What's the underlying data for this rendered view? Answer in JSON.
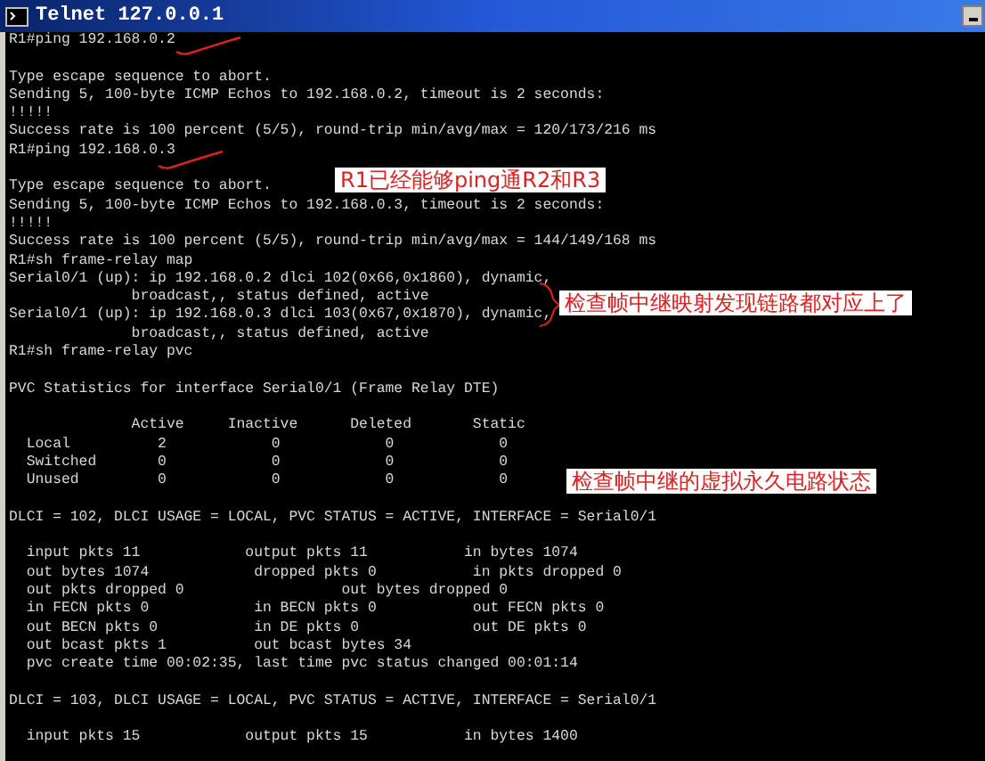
{
  "window": {
    "title": "Telnet 127.0.0.1"
  },
  "terminal": {
    "blocks": [
      {
        "lines": [
          "R1#ping 192.168.0.2"
        ]
      },
      {
        "lines": [
          "Type escape sequence to abort.",
          "Sending 5, 100-byte ICMP Echos to 192.168.0.2, timeout is 2 seconds:",
          "!!!!!",
          "Success rate is 100 percent (5/5), round-trip min/avg/max = 120/173/216 ms",
          "R1#ping 192.168.0.3"
        ]
      },
      {
        "lines": [
          "Type escape sequence to abort.",
          "Sending 5, 100-byte ICMP Echos to 192.168.0.3, timeout is 2 seconds:",
          "!!!!!",
          "Success rate is 100 percent (5/5), round-trip min/avg/max = 144/149/168 ms",
          "R1#sh frame-relay map",
          "Serial0/1 (up): ip 192.168.0.2 dlci 102(0x66,0x1860), dynamic,",
          "              broadcast,, status defined, active",
          "Serial0/1 (up): ip 192.168.0.3 dlci 103(0x67,0x1870), dynamic,",
          "              broadcast,, status defined, active",
          "R1#sh frame-relay pvc"
        ]
      },
      {
        "lines": [
          "PVC Statistics for interface Serial0/1 (Frame Relay DTE)"
        ]
      },
      {
        "lines": [
          "              Active     Inactive      Deleted       Static",
          "  Local          2            0            0            0",
          "  Switched       0            0            0            0",
          "  Unused         0            0            0            0"
        ]
      },
      {
        "lines": [
          "DLCI = 102, DLCI USAGE = LOCAL, PVC STATUS = ACTIVE, INTERFACE = Serial0/1"
        ]
      },
      {
        "lines": [
          "  input pkts 11            output pkts 11           in bytes 1074",
          "  out bytes 1074            dropped pkts 0           in pkts dropped 0",
          "  out pkts dropped 0                  out bytes dropped 0",
          "  in FECN pkts 0            in BECN pkts 0           out FECN pkts 0",
          "  out BECN pkts 0           in DE pkts 0             out DE pkts 0",
          "  out bcast pkts 1          out bcast bytes 34",
          "  pvc create time 00:02:35, last time pvc status changed 00:01:14"
        ]
      },
      {
        "lines": [
          "DLCI = 103, DLCI USAGE = LOCAL, PVC STATUS = ACTIVE, INTERFACE = Serial0/1"
        ]
      },
      {
        "lines": [
          "  input pkts 15            output pkts 15           in bytes 1400"
        ]
      }
    ]
  },
  "annotations": [
    {
      "kind": "check"
    },
    {
      "kind": "check"
    },
    {
      "kind": "label",
      "text": "R1已经能够ping通R2和R3"
    },
    {
      "kind": "brace"
    },
    {
      "kind": "label",
      "text": "检查帧中继映射发现链路都对应上了"
    },
    {
      "kind": "label",
      "text": "检查帧中继的虚拟永久电路状态"
    }
  ]
}
